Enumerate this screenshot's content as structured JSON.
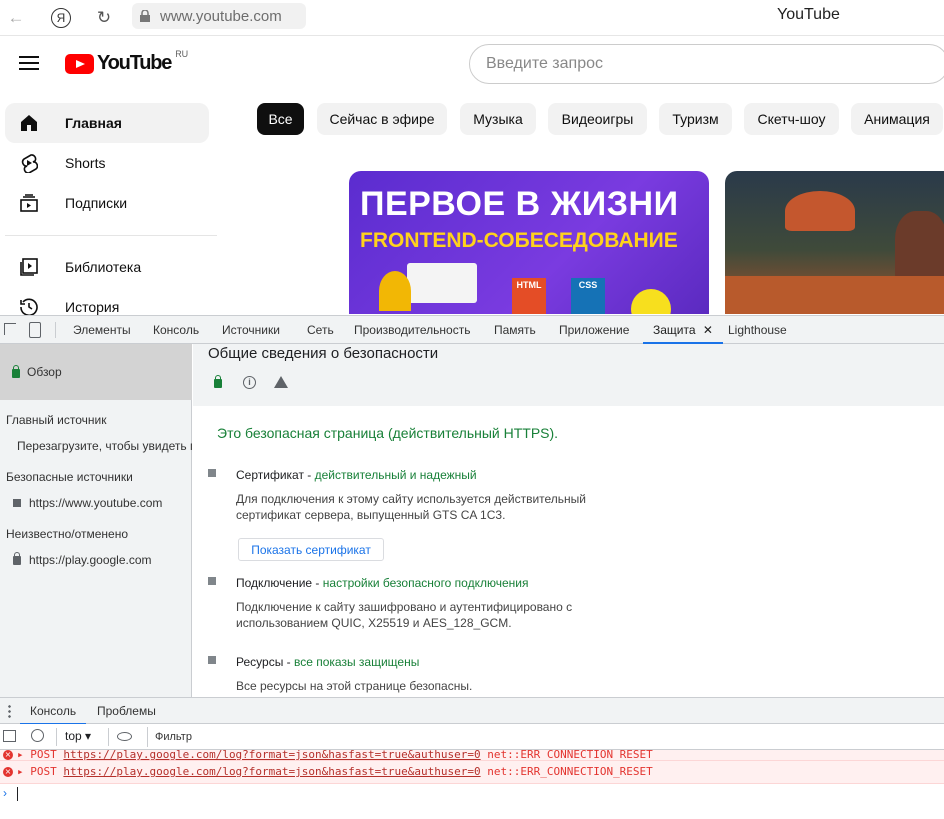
{
  "browser": {
    "url": "www.youtube.com",
    "tab_title": "YouTube",
    "yandex_glyph": "Я"
  },
  "youtube": {
    "logo_text": "YouTube",
    "logo_region": "RU",
    "search_placeholder": "Введите запрос",
    "sidebar": [
      {
        "label": "Главная",
        "icon": "home-icon",
        "active": true
      },
      {
        "label": "Shorts",
        "icon": "shorts-icon"
      },
      {
        "label": "Подписки",
        "icon": "subscriptions-icon"
      },
      {
        "label": "Библиотека",
        "icon": "library-icon"
      },
      {
        "label": "История",
        "icon": "history-icon"
      }
    ],
    "chips": [
      "Все",
      "Сейчас в эфире",
      "Музыка",
      "Видеоигры",
      "Туризм",
      "Скетч-шоу",
      "Анимация"
    ],
    "thumb1": {
      "line1": "ПЕРВОЕ В ЖИЗНИ",
      "line2": "FRONTEND-СОБЕСЕДОВАНИЕ",
      "badge_html": "HTML",
      "badge_css": "CSS"
    }
  },
  "devtools": {
    "tabs": [
      "Элементы",
      "Консоль",
      "Источники",
      "Сеть",
      "Производительность",
      "Память",
      "Приложение",
      "Защита",
      "Lighthouse"
    ],
    "active_tab": "Защита",
    "close_glyph": "✕",
    "security": {
      "overview": "Обзор",
      "main_origin_heading": "Главный источник",
      "reload_hint": "Перезагрузите, чтобы увидеть г",
      "secure_origins_heading": "Безопасные источники",
      "secure_origin": "https://www.youtube.com",
      "unknown_heading": "Неизвестно/отменено",
      "unknown_origin": "https://play.google.com",
      "title": "Общие сведения о безопасности",
      "summary": "Это безопасная страница (действительный HTTPS).",
      "cert_label": "Сертификат - ",
      "cert_status": "действительный и надежный",
      "cert_desc": "Для подключения к этому сайту используется действительный сертификат сервера, выпущенный GTS CA 1C3.",
      "cert_button": "Показать сертификат",
      "conn_label": "Подключение - ",
      "conn_status": "настройки безопасного подключения",
      "conn_desc": "Подключение к сайту зашифровано и аутентифицировано с использованием QUIC, X25519 и AES_128_GCM.",
      "res_label": "Ресурсы - ",
      "res_status": "все показы защищены",
      "res_desc": "Все ресурсы на этой странице безопасны."
    },
    "drawer": {
      "tabs": [
        "Консоль",
        "Проблемы"
      ],
      "context": "top",
      "filter_placeholder": "Фильтр",
      "messages": [
        {
          "method": "POST",
          "url": "https://play.google.com/log?format=json&hasfast=true&authuser=0",
          "error": "net::ERR_CONNECTION_RESET"
        },
        {
          "method": "POST",
          "url": "https://play.google.com/log?format=json&hasfast=true&authuser=0",
          "error": "net::ERR_CONNECTION_RESET"
        }
      ],
      "prompt": "›"
    }
  }
}
